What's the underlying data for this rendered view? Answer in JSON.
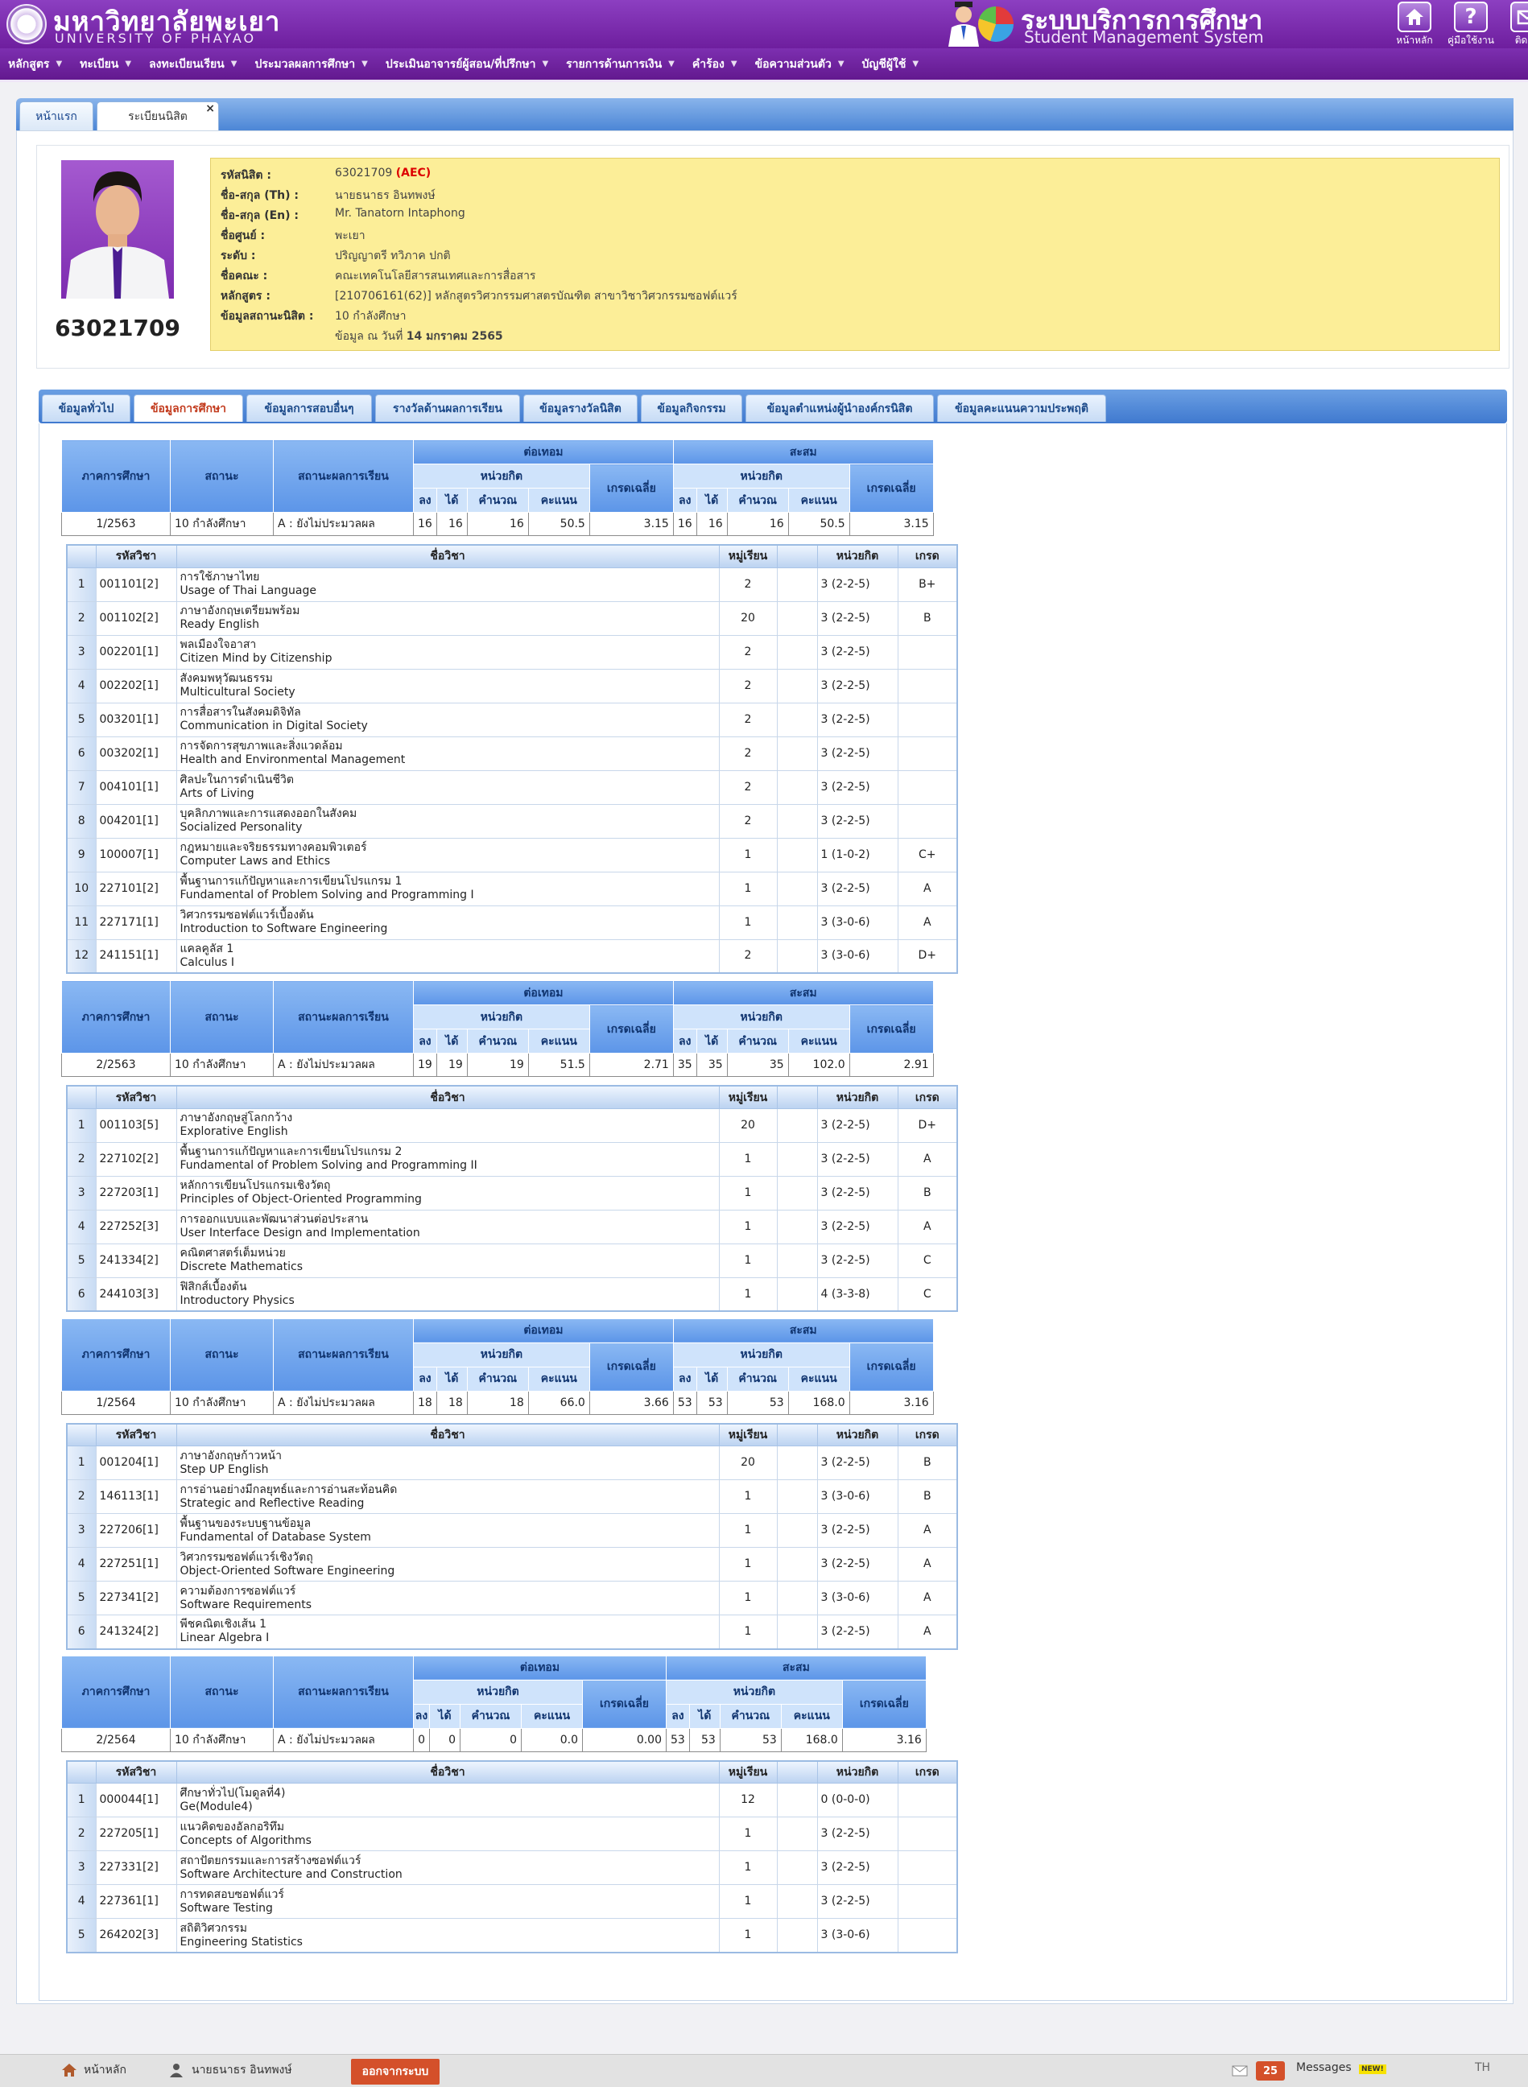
{
  "header": {
    "university_th": "มหาวิทยาลัยพะเยา",
    "university_en": "UNIVERSITY OF PHAYAO",
    "system_th": "ระบบบริการการศึกษา",
    "system_en": "Student Management System",
    "buttons": [
      {
        "label": "หน้าหลัก",
        "icon": "home-icon"
      },
      {
        "label": "คู่มือใช้งาน",
        "icon": "help-icon"
      },
      {
        "label": "ติดต่อ",
        "icon": "mail-icon"
      }
    ]
  },
  "menu": [
    {
      "label": "หลักสูตร"
    },
    {
      "label": "ทะเบียน"
    },
    {
      "label": "ลงทะเบียนเรียน"
    },
    {
      "label": "ประมวลผลการศึกษา"
    },
    {
      "label": "ประเมินอาจารย์ผู้สอน/ที่ปรึกษา"
    },
    {
      "label": "รายการด้านการเงิน"
    },
    {
      "label": "คำร้อง"
    },
    {
      "label": "ข้อความส่วนตัว"
    },
    {
      "label": "บัญชีผู้ใช้"
    }
  ],
  "page_tabs": [
    {
      "label": "หน้าแรก"
    },
    {
      "label": "ระเบียนนิสิต",
      "close": "×"
    }
  ],
  "profile": {
    "student_id_big": "63021709",
    "rows": [
      {
        "label": "รหัสนิสิต :",
        "value": "63021709",
        "extra": "(AEC)"
      },
      {
        "label": "ชื่อ-สกุล (Th) :",
        "value": "นายธนาธร อินทพงษ์"
      },
      {
        "label": "ชื่อ-สกุล (En) :",
        "value": "Mr. Tanatorn Intaphong"
      },
      {
        "label": "ชื่อศูนย์ :",
        "value": "พะเยา"
      },
      {
        "label": "ระดับ :",
        "value": "ปริญญาตรี ทวิภาค ปกติ"
      },
      {
        "label": "ชื่อคณะ :",
        "value": "คณะเทคโนโลยีสารสนเทศและการสื่อสาร"
      },
      {
        "label": "หลักสูตร :",
        "value": "[210706161(62)] หลักสูตรวิศวกรรมศาสตรบัณฑิต สาขาวิชาวิศวกรรมซอฟต์แวร์"
      },
      {
        "label": "ข้อมูลสถานะนิสิต :",
        "value": "10 กำลังศึกษา"
      }
    ],
    "asof_prefix": "ข้อมูล ณ วันที่",
    "asof_date": "14 มกราคม 2565"
  },
  "sub_tabs": [
    {
      "label": "ข้อมูลทั่วไป"
    },
    {
      "label": "ข้อมูลการศึกษา"
    },
    {
      "label": "ข้อมูลการสอบอื่นๆ"
    },
    {
      "label": "รางวัลด้านผลการเรียน"
    },
    {
      "label": "ข้อมูลรางวัลนิสิต"
    },
    {
      "label": "ข้อมูลกิจกรรม"
    },
    {
      "label": "ข้อมูลตำแหน่งผู้นำองค์กรนิสิต"
    },
    {
      "label": "ข้อมูลคะแนนความประพฤติ"
    }
  ],
  "sem_headers": {
    "term": "ภาคการศึกษา",
    "status": "สถานะ",
    "result_status": "สถานะผลการเรียน",
    "per_term": "ต่อเทอม",
    "cumulative": "สะสม",
    "credits": "หน่วยกิต",
    "gpa": "เกรดเฉลี่ย",
    "reg": "ลง",
    "earned": "ได้",
    "calc": "คำนวณ",
    "points": "คะแนน"
  },
  "course_headers": {
    "code": "รหัสวิชา",
    "name": "ชื่อวิชา",
    "section": "หมู่เรียน",
    "credits": "หน่วยกิต",
    "grade": "เกรด"
  },
  "semesters": [
    {
      "term": "1/2563",
      "status": "10 กำลังศึกษา",
      "result": "A : ยังไม่ประมวลผล",
      "t_reg": "16",
      "t_earn": "16",
      "t_calc": "16",
      "t_pts": "50.5",
      "t_gpa": "3.15",
      "c_reg": "16",
      "c_earn": "16",
      "c_calc": "16",
      "c_pts": "50.5",
      "c_gpa": "3.15",
      "courses": [
        {
          "no": "1",
          "code": "001101[2]",
          "th": "การใช้ภาษาไทย",
          "en": "Usage of Thai Language",
          "sec": "2",
          "cr": "3 (2-2-5)",
          "grade": "B+"
        },
        {
          "no": "2",
          "code": "001102[2]",
          "th": "ภาษาอังกฤษเตรียมพร้อม",
          "en": "Ready English",
          "sec": "20",
          "cr": "3 (2-2-5)",
          "grade": "B"
        },
        {
          "no": "3",
          "code": "002201[1]",
          "th": "พลเมืองใจอาสา",
          "en": "Citizen Mind by Citizenship",
          "sec": "2",
          "cr": "3 (2-2-5)",
          "grade": ""
        },
        {
          "no": "4",
          "code": "002202[1]",
          "th": "สังคมพหุวัฒนธรรม",
          "en": "Multicultural Society",
          "sec": "2",
          "cr": "3 (2-2-5)",
          "grade": ""
        },
        {
          "no": "5",
          "code": "003201[1]",
          "th": "การสื่อสารในสังคมดิจิทัล",
          "en": "Communication in Digital Society",
          "sec": "2",
          "cr": "3 (2-2-5)",
          "grade": ""
        },
        {
          "no": "6",
          "code": "003202[1]",
          "th": "การจัดการสุขภาพและสิ่งแวดล้อม",
          "en": "Health and Environmental Management",
          "sec": "2",
          "cr": "3 (2-2-5)",
          "grade": ""
        },
        {
          "no": "7",
          "code": "004101[1]",
          "th": "ศิลปะในการดำเนินชีวิต",
          "en": "Arts of Living",
          "sec": "2",
          "cr": "3 (2-2-5)",
          "grade": ""
        },
        {
          "no": "8",
          "code": "004201[1]",
          "th": "บุคลิกภาพและการแสดงออกในสังคม",
          "en": "Socialized Personality",
          "sec": "2",
          "cr": "3 (2-2-5)",
          "grade": ""
        },
        {
          "no": "9",
          "code": "100007[1]",
          "th": "กฎหมายและจริยธรรมทางคอมพิวเตอร์",
          "en": "Computer Laws and Ethics",
          "sec": "1",
          "cr": "1 (1-0-2)",
          "grade": "C+"
        },
        {
          "no": "10",
          "code": "227101[2]",
          "th": "พื้นฐานการแก้ปัญหาและการเขียนโปรแกรม 1",
          "en": "Fundamental of Problem Solving and Programming I",
          "sec": "1",
          "cr": "3 (2-2-5)",
          "grade": "A"
        },
        {
          "no": "11",
          "code": "227171[1]",
          "th": "วิศวกรรมซอฟต์แวร์เบื้องต้น",
          "en": "Introduction to Software Engineering",
          "sec": "1",
          "cr": "3 (3-0-6)",
          "grade": "A"
        },
        {
          "no": "12",
          "code": "241151[1]",
          "th": "แคลคูลัส 1",
          "en": "Calculus I",
          "sec": "2",
          "cr": "3 (3-0-6)",
          "grade": "D+"
        }
      ]
    },
    {
      "term": "2/2563",
      "status": "10 กำลังศึกษา",
      "result": "A : ยังไม่ประมวลผล",
      "t_reg": "19",
      "t_earn": "19",
      "t_calc": "19",
      "t_pts": "51.5",
      "t_gpa": "2.71",
      "c_reg": "35",
      "c_earn": "35",
      "c_calc": "35",
      "c_pts": "102.0",
      "c_gpa": "2.91",
      "courses": [
        {
          "no": "1",
          "code": "001103[5]",
          "th": "ภาษาอังกฤษสู่โลกกว้าง",
          "en": "Explorative English",
          "sec": "20",
          "cr": "3 (2-2-5)",
          "grade": "D+"
        },
        {
          "no": "2",
          "code": "227102[2]",
          "th": "พื้นฐานการแก้ปัญหาและการเขียนโปรแกรม 2",
          "en": "Fundamental of Problem Solving and Programming II",
          "sec": "1",
          "cr": "3 (2-2-5)",
          "grade": "A"
        },
        {
          "no": "3",
          "code": "227203[1]",
          "th": "หลักการเขียนโปรแกรมเชิงวัตถุ",
          "en": "Principles of Object-Oriented Programming",
          "sec": "1",
          "cr": "3 (2-2-5)",
          "grade": "B"
        },
        {
          "no": "4",
          "code": "227252[3]",
          "th": "การออกแบบและพัฒนาส่วนต่อประสาน",
          "en": "User Interface Design and Implementation",
          "sec": "1",
          "cr": "3 (2-2-5)",
          "grade": "A"
        },
        {
          "no": "5",
          "code": "241334[2]",
          "th": "คณิตศาสตร์เต็มหน่วย",
          "en": "Discrete Mathematics",
          "sec": "1",
          "cr": "3 (2-2-5)",
          "grade": "C"
        },
        {
          "no": "6",
          "code": "244103[3]",
          "th": "ฟิสิกส์เบื้องต้น",
          "en": "Introductory Physics",
          "sec": "1",
          "cr": "4 (3-3-8)",
          "grade": "C"
        }
      ]
    },
    {
      "term": "1/2564",
      "status": "10 กำลังศึกษา",
      "result": "A : ยังไม่ประมวลผล",
      "t_reg": "18",
      "t_earn": "18",
      "t_calc": "18",
      "t_pts": "66.0",
      "t_gpa": "3.66",
      "c_reg": "53",
      "c_earn": "53",
      "c_calc": "53",
      "c_pts": "168.0",
      "c_gpa": "3.16",
      "courses": [
        {
          "no": "1",
          "code": "001204[1]",
          "th": "ภาษาอังกฤษก้าวหน้า",
          "en": "Step UP English",
          "sec": "20",
          "cr": "3 (2-2-5)",
          "grade": "B"
        },
        {
          "no": "2",
          "code": "146113[1]",
          "th": "การอ่านอย่างมีกลยุทธ์และการอ่านสะท้อนคิด",
          "en": "Strategic and Reflective Reading",
          "sec": "1",
          "cr": "3 (3-0-6)",
          "grade": "B"
        },
        {
          "no": "3",
          "code": "227206[1]",
          "th": "พื้นฐานของระบบฐานข้อมูล",
          "en": "Fundamental of Database System",
          "sec": "1",
          "cr": "3 (2-2-5)",
          "grade": "A"
        },
        {
          "no": "4",
          "code": "227251[1]",
          "th": "วิศวกรรมซอฟต์แวร์เชิงวัตถุ",
          "en": "Object-Oriented Software Engineering",
          "sec": "1",
          "cr": "3 (2-2-5)",
          "grade": "A"
        },
        {
          "no": "5",
          "code": "227341[2]",
          "th": "ความต้องการซอฟต์แวร์",
          "en": "Software Requirements",
          "sec": "1",
          "cr": "3 (3-0-6)",
          "grade": "A"
        },
        {
          "no": "6",
          "code": "241324[2]",
          "th": "พีชคณิตเชิงเส้น 1",
          "en": "Linear Algebra I",
          "sec": "1",
          "cr": "3 (2-2-5)",
          "grade": "A"
        }
      ]
    },
    {
      "term": "2/2564",
      "status": "10 กำลังศึกษา",
      "result": "A : ยังไม่ประมวลผล",
      "t_reg": "0",
      "t_earn": "0",
      "t_calc": "0",
      "t_pts": "0.0",
      "t_gpa": "0.00",
      "c_reg": "53",
      "c_earn": "53",
      "c_calc": "53",
      "c_pts": "168.0",
      "c_gpa": "3.16",
      "courses": [
        {
          "no": "1",
          "code": "000044[1]",
          "th": "ศึกษาทั่วไป(โมดูลที่4)",
          "en": "Ge(Module4)",
          "sec": "12",
          "cr": "0 (0-0-0)",
          "grade": ""
        },
        {
          "no": "2",
          "code": "227205[1]",
          "th": "แนวคิดของอัลกอริทึม",
          "en": "Concepts of Algorithms",
          "sec": "1",
          "cr": "3 (2-2-5)",
          "grade": ""
        },
        {
          "no": "3",
          "code": "227331[2]",
          "th": "สถาปัตยกรรมและการสร้างซอฟต์แวร์",
          "en": "Software Architecture and Construction",
          "sec": "1",
          "cr": "3 (2-2-5)",
          "grade": ""
        },
        {
          "no": "4",
          "code": "227361[1]",
          "th": "การทดสอบซอฟต์แวร์",
          "en": "Software Testing",
          "sec": "1",
          "cr": "3 (2-2-5)",
          "grade": ""
        },
        {
          "no": "5",
          "code": "264202[3]",
          "th": "สถิติวิศวกรรม",
          "en": "Engineering Statistics",
          "sec": "1",
          "cr": "3 (3-0-6)",
          "grade": ""
        }
      ]
    }
  ],
  "footer": {
    "home": "หน้าหลัก",
    "user": "นายธนาธร อินทพงษ์",
    "logout": "ออกจากระบบ",
    "msg_count": "25",
    "messages": "Messages",
    "new_badge": "NEW!",
    "lang": "TH"
  }
}
